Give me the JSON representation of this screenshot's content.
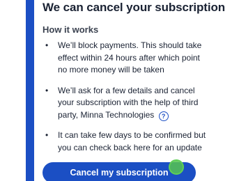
{
  "page": {
    "title": "We can cancel your subscription",
    "section_heading": "How it works"
  },
  "steps": [
    {
      "bullet": "•",
      "text": "We’ll block payments. This should take effect within 24 hours after which point no more money will be taken"
    },
    {
      "bullet": "•",
      "text": "We’ll ask for a few details and cancel your subscription with the help of third party, Minna Technologies",
      "help_icon": "question-circle-icon",
      "help_glyph": "?"
    },
    {
      "bullet": "•",
      "text": "It can take few days to be confirmed but you can check back here for an update"
    }
  ],
  "cta": {
    "label": "Cancel my subscription"
  },
  "colors": {
    "accent": "#1b4fc4",
    "touch_indicator": "#5fcf56"
  }
}
